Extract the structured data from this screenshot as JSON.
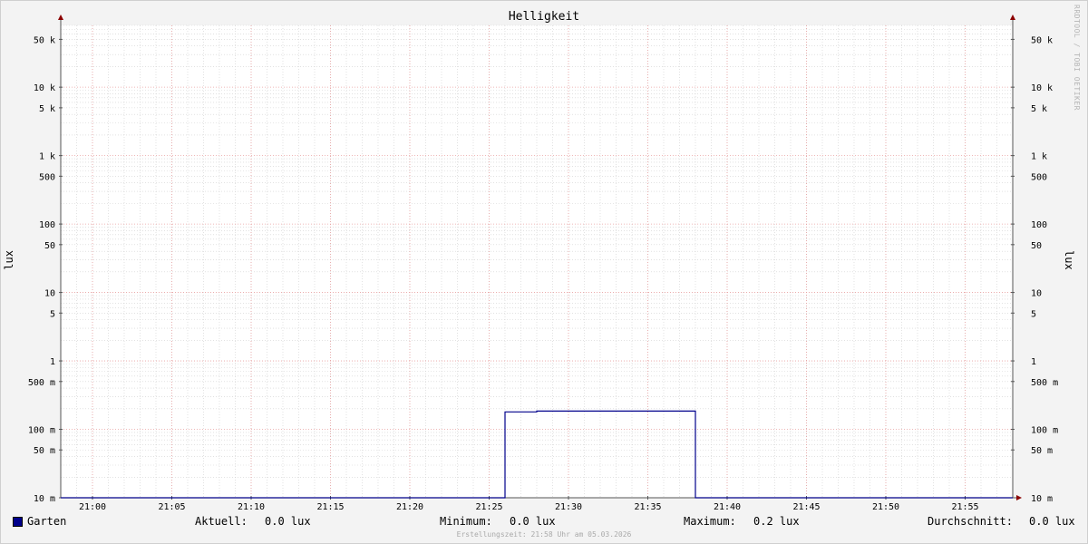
{
  "chart_data": {
    "type": "line",
    "title": "Helligkeit",
    "ylabel": "lux",
    "y_scale": "log",
    "ylim": [
      0.01,
      80000
    ],
    "xlim": [
      "20:58",
      "21:58"
    ],
    "y_ticks": [
      {
        "value": 50000,
        "label": "50 k"
      },
      {
        "value": 10000,
        "label": "10 k"
      },
      {
        "value": 5000,
        "label": "5 k"
      },
      {
        "value": 1000,
        "label": "1 k"
      },
      {
        "value": 500,
        "label": "500"
      },
      {
        "value": 100,
        "label": "100"
      },
      {
        "value": 50,
        "label": "50"
      },
      {
        "value": 10,
        "label": "10"
      },
      {
        "value": 5,
        "label": "5"
      },
      {
        "value": 1,
        "label": "1"
      },
      {
        "value": 0.5,
        "label": "500 m"
      },
      {
        "value": 0.1,
        "label": "100 m"
      },
      {
        "value": 0.05,
        "label": "50 m"
      },
      {
        "value": 0.01,
        "label": "10 m"
      }
    ],
    "x_ticks": [
      "21:00",
      "21:05",
      "21:10",
      "21:15",
      "21:20",
      "21:25",
      "21:30",
      "21:35",
      "21:40",
      "21:45",
      "21:50",
      "21:55"
    ],
    "series": [
      {
        "name": "Garten",
        "color": "#00008b",
        "points": [
          {
            "x": "20:58",
            "y": 0.01
          },
          {
            "x": "21:26",
            "y": 0.01
          },
          {
            "x": "21:26",
            "y": 0.18
          },
          {
            "x": "21:28",
            "y": 0.18
          },
          {
            "x": "21:28",
            "y": 0.185
          },
          {
            "x": "21:38",
            "y": 0.185
          },
          {
            "x": "21:38",
            "y": 0.01
          },
          {
            "x": "21:58",
            "y": 0.01
          }
        ]
      }
    ],
    "grid": true,
    "mirrored_right_axis": true
  },
  "watermark": "RRDTOOL / TOBI OETIKER",
  "legend": {
    "name": "Garten",
    "aktuell_label": "Aktuell:",
    "aktuell_value": "0.0 lux",
    "minimum_label": "Minimum:",
    "minimum_value": "0.0 lux",
    "maximum_label": "Maximum:",
    "maximum_value": "0.2 lux",
    "durchschnitt_label": "Durchschnitt:",
    "durchschnitt_value": "0.0 lux"
  },
  "footer": "Erstellungszeit: 21:58 Uhr am 05.03.2026",
  "colors": {
    "major_grid": "#e8a0a0",
    "minor_grid": "#d0d0d0",
    "axis": "#555555",
    "arrow": "#8b0000",
    "line": "#00008b"
  }
}
